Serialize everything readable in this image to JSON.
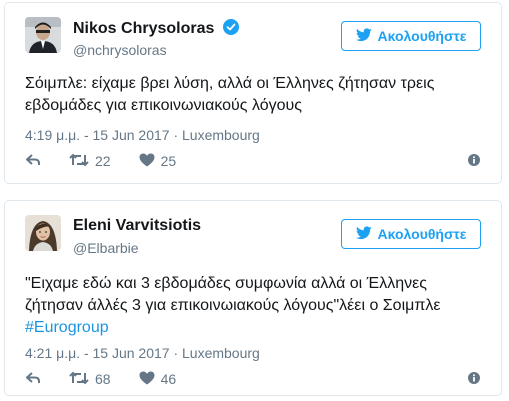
{
  "tweets": [
    {
      "name": "Nikos Chrysoloras",
      "verified": true,
      "handle": "@nchrysoloras",
      "follow_label": "Ακολουθήστε",
      "text": "Σόιμπλε: είχαμε βρει λύση, αλλά οι Έλληνες ζήτησαν τρεις εβδομάδες για επικοινωνιακούς λόγους",
      "hashtag": "",
      "meta": "4:19 μ.μ. - 15 Jun 2017 · Luxembourg",
      "retweets": "22",
      "likes": "25"
    },
    {
      "name": "Eleni Varvitsiotis",
      "verified": false,
      "handle": "@Elbarbie",
      "follow_label": "Ακολουθήστε",
      "text": "\"Ειχαμε εδώ και 3 εβδομάδες συμφωνία αλλά οι Έλληνες ζήτησαν άλλές 3 για επικοινωιακούς λόγους\"λέει ο Σοιμπλε",
      "hashtag": "#Eurogroup",
      "meta": "4:21 μ.μ. - 15 Jun 2017 · Luxembourg",
      "retweets": "68",
      "likes": "46"
    }
  ],
  "colors": {
    "accent": "#1da1f2",
    "hashtag": "#1b95e0",
    "muted": "#657786",
    "text": "#14171a",
    "border": "#e1e8ed"
  }
}
